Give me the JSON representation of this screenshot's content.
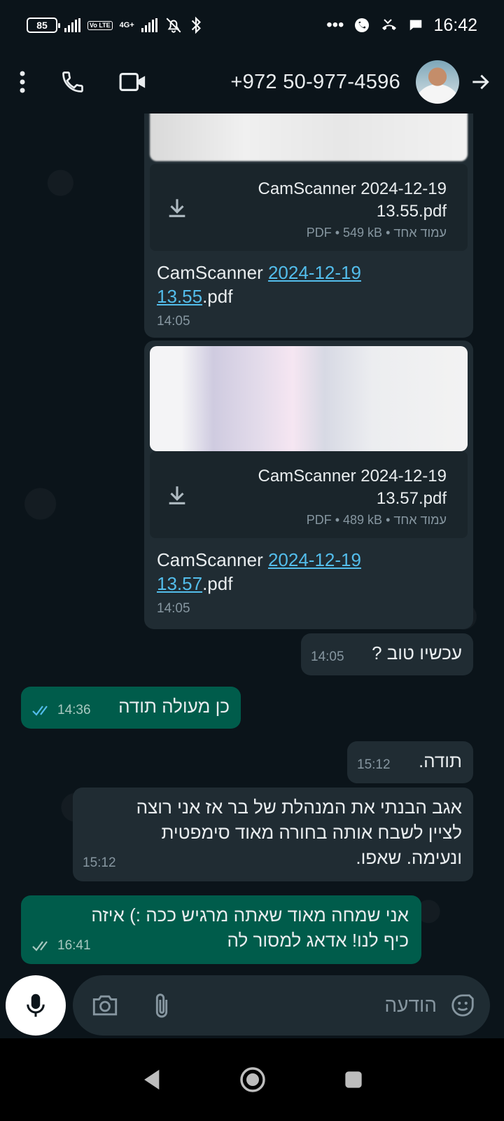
{
  "status_bar": {
    "battery": "85",
    "network": "4G+",
    "volte": "Vo LTE",
    "overflow": "•••",
    "time": "16:42"
  },
  "header": {
    "contact_name": "+972 50-977-4596"
  },
  "messages": [
    {
      "type": "document",
      "direction": "incoming",
      "doc_title_line1": "CamScanner 2024-12-19",
      "doc_title_line2": "13.55.pdf",
      "doc_meta": "PDF • 549 kB • עמוד אחד",
      "caption_prefix": "CamScanner ",
      "caption_link1": "2024-12-19",
      "caption_link2": "13.55",
      "caption_suffix": ".pdf",
      "time": "14:05"
    },
    {
      "type": "document",
      "direction": "incoming",
      "doc_title_line1": "CamScanner 2024-12-19",
      "doc_title_line2": "13.57.pdf",
      "doc_meta": "PDF • 489 kB • עמוד אחד",
      "caption_prefix": "CamScanner ",
      "caption_link1": "2024-12-19",
      "caption_link2": "13.57",
      "caption_suffix": ".pdf",
      "time": "14:05"
    },
    {
      "type": "text",
      "direction": "incoming",
      "text": "עכשיו טוב ?",
      "time": "14:05"
    },
    {
      "type": "text",
      "direction": "outgoing",
      "text": "כן מעולה תודה",
      "time": "14:36"
    },
    {
      "type": "text",
      "direction": "incoming",
      "text": "תודה.",
      "time": "15:12"
    },
    {
      "type": "text",
      "direction": "incoming",
      "line1": "אגב הבנתי את המנהלת של בר אז אני רוצה",
      "line2": "לציין לשבח אותה בחורה מאוד סימפטית",
      "line3": "ונעימה. שאפו.",
      "time": "15:12"
    },
    {
      "type": "text",
      "direction": "outgoing",
      "line1": "אני שמחה מאוד שאתה מרגיש ככה :) איזה",
      "line2": "כיף לנו! אדאג למסור לה",
      "time": "16:41"
    }
  ],
  "composer": {
    "placeholder": "הודעה"
  },
  "colors": {
    "background": "#0b141a",
    "incoming_bubble": "#202c33",
    "outgoing_bubble": "#005c4b",
    "link": "#53bdeb",
    "read_ticks": "#53bdeb"
  }
}
